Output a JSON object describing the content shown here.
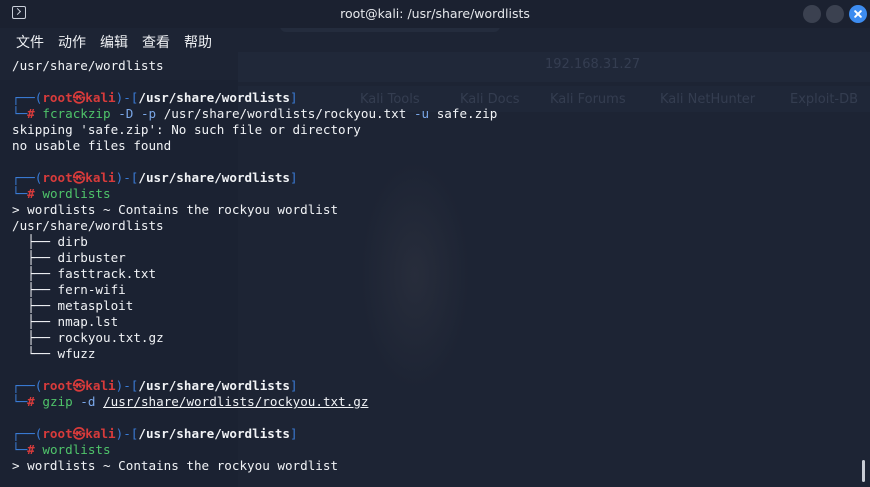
{
  "window": {
    "title": "root@kali: /usr/share/wordlists"
  },
  "menu": [
    "文件",
    "动作",
    "编辑",
    "查看",
    "帮助"
  ],
  "background": {
    "ghost_texts": [
      "192.168.31.27",
      "Kali Tools",
      "Kali Docs",
      "Kali Forums",
      "Kali NetHunter",
      "Exploit-DB"
    ]
  },
  "terminal": {
    "user": "root",
    "at": "㉿",
    "host": "kali",
    "cwd": "/usr/share/wordlists",
    "line_pwd": "/usr/share/wordlists",
    "cmd1": {
      "name": "fcrackzip",
      "args": [
        " ",
        "-D",
        " ",
        "-p",
        " /usr/share/wordlists/rockyou.txt ",
        "-u",
        " safe.zip"
      ]
    },
    "out1": [
      "skipping 'safe.zip': No such file or directory",
      "no usable files found"
    ],
    "cmd2": "wordlists",
    "out2_head": [
      "> wordlists ~ Contains the rockyou wordlist",
      "/usr/share/wordlists"
    ],
    "tree": [
      "├── dirb",
      "├── dirbuster",
      "├── fasttrack.txt",
      "├── fern-wifi",
      "├── metasploit",
      "├── nmap.lst",
      "├── rockyou.txt.gz",
      "└── wfuzz"
    ],
    "cmd3": {
      "name": "gzip",
      "flag": "-d",
      "file": "/usr/share/wordlists/rockyou.txt.gz"
    },
    "cmd4": "wordlists",
    "out4": "> wordlists ~ Contains the rockyou wordlist"
  },
  "colors": {
    "background": "#1d2434",
    "prompt_blue": "#3a7bd5",
    "prompt_red": "#d83b3b",
    "command_green": "#4fc46a"
  }
}
